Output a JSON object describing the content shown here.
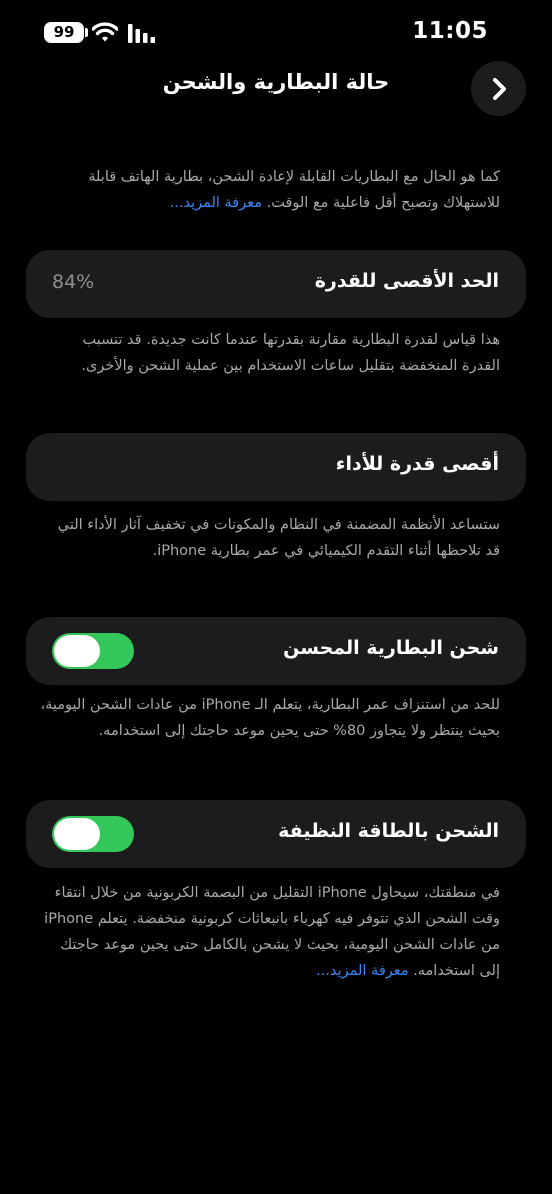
{
  "status_bar": {
    "battery_level": "99",
    "time": "11:05"
  },
  "header": {
    "title": "حالة البطارية والشحن",
    "back_icon": "chevron-right-icon"
  },
  "intro": {
    "text": "كما هو الحال مع البطاريات القابلة لإعادة الشحن، بطارية الهاتف قابلة للاستهلاك وتصبح أقل فاعلية مع الوقت. ",
    "link": "معرفة المزيد..."
  },
  "max_capacity": {
    "label": "الحد الأقصى للقدرة",
    "value": "84%",
    "description": "هذا قياس لقدرة البطارية مقارنة بقدرتها عندما كانت جديدة. قد تتسبب القدرة المنخفضة بتقليل ساعات الاستخدام بين عملية الشحن والأخرى."
  },
  "peak_performance": {
    "label": "أقصى قدرة للأداء",
    "description": "ستساعد الأنظمة المضمنة في النظام والمكونات في تخفيف آثار الأداء التي قد تلاحظها أثناء التقدم الكيميائي في عمر بطارية iPhone."
  },
  "optimized_charging": {
    "label": "شحن البطارية المحسن",
    "enabled": true,
    "description": "للحد من استنزاف عمر البطارية، يتعلم الـ iPhone من عادات الشحن اليومية، بحيث ينتظر ولا يتجاوز 80% حتى يحين موعد حاجتك إلى استخدامه."
  },
  "clean_energy": {
    "label": "الشحن بالطاقة النظيفة",
    "enabled": true,
    "description": "في منطقتك، سيحاول iPhone التقليل من البصمة الكربونية من خلال انتقاء وقت الشحن الذي تتوفر فيه كهرباء بانبعاثات كربونية منخفضة. يتعلم iPhone من عادات الشحن اليومية، بحيث لا يشحن بالكامل حتى يحين موعد حاجتك إلى استخدامه. ",
    "link": "معرفة المزيد..."
  },
  "colors": {
    "background": "#000000",
    "card": "#1c1c1e",
    "toggle_on": "#34c759",
    "link": "#3a87f6",
    "secondary_text": "#a8a8ad"
  }
}
